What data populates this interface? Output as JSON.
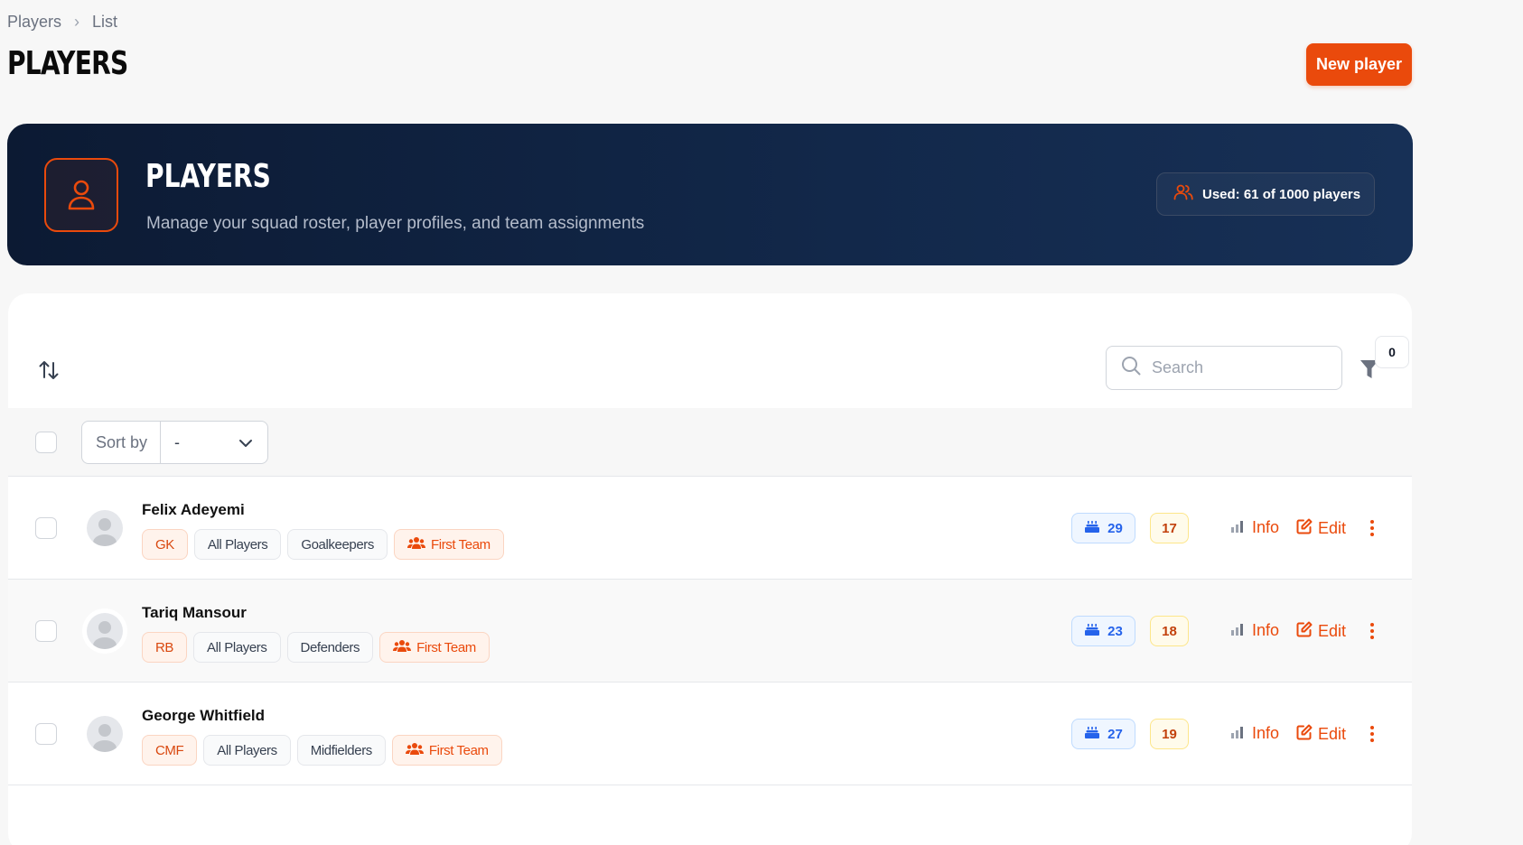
{
  "breadcrumb": {
    "items": [
      "Players",
      "List"
    ]
  },
  "page": {
    "title": "PLAYERS",
    "new_button": "New player"
  },
  "hero": {
    "title": "PLAYERS",
    "subtitle": "Manage your squad roster, player profiles, and team assignments",
    "usage": "Used: 61 of 1000 players",
    "icon": "user-icon"
  },
  "toolbar": {
    "search_placeholder": "Search",
    "filter_count": "0",
    "sort_label": "Sort by",
    "sort_value": "-"
  },
  "players": [
    {
      "name": "Felix Adeyemi",
      "position": "GK",
      "groups": [
        "All Players",
        "Goalkeepers"
      ],
      "team": "First Team",
      "age": "29",
      "number": "17"
    },
    {
      "name": "Tariq Mansour",
      "position": "RB",
      "groups": [
        "All Players",
        "Defenders"
      ],
      "team": "First Team",
      "age": "23",
      "number": "18"
    },
    {
      "name": "George Whitfield",
      "position": "CMF",
      "groups": [
        "All Players",
        "Midfielders"
      ],
      "team": "First Team",
      "age": "27",
      "number": "19"
    }
  ],
  "actions": {
    "info": "Info",
    "edit": "Edit"
  },
  "colors": {
    "accent": "#ea4a0c",
    "hero_bg": "#0c1a33",
    "age_badge": "#2563eb"
  }
}
